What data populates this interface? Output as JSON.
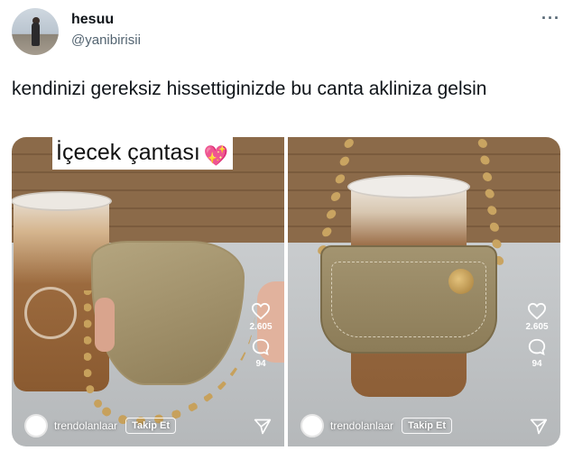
{
  "tweet": {
    "display_name": "hesuu",
    "handle": "@yanibirisii",
    "more_label": "···",
    "text": "kendinizi gereksiz hissettiginizde bu canta akliniza gelsin"
  },
  "media": {
    "overlay_caption": "İçecek çantası",
    "overlay_emoji": "💖",
    "videos": [
      {
        "likes": "2.605",
        "comments": "94",
        "username": "trendolanlaar",
        "follow_label": "Takip Et",
        "icons": [
          "heart-icon",
          "comment-icon",
          "share-icon"
        ]
      },
      {
        "likes": "2.605",
        "comments": "94",
        "username": "trendolanlaar",
        "follow_label": "Takip Et",
        "icons": [
          "heart-icon",
          "comment-icon",
          "share-icon"
        ]
      }
    ]
  },
  "colors": {
    "text_primary": "#0f1419",
    "text_secondary": "#536471",
    "overlay_text": "#ffffff"
  }
}
